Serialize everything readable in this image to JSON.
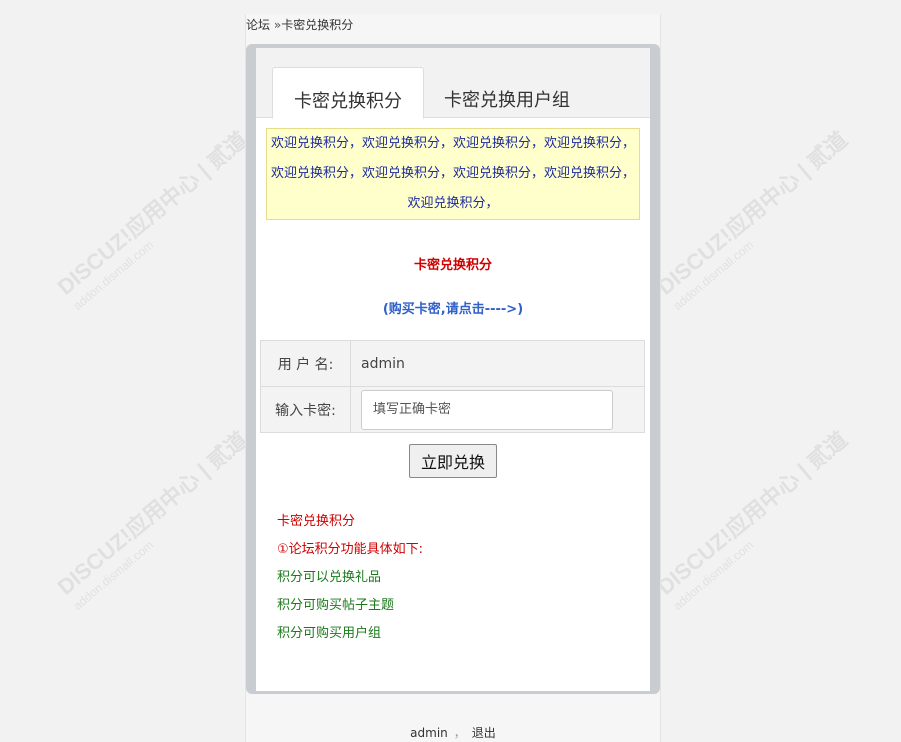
{
  "breadcrumb": {
    "forum": "论坛",
    "separator": "»",
    "current": "卡密兑换积分"
  },
  "tabs": [
    {
      "label": "卡密兑换积分",
      "active": true
    },
    {
      "label": "卡密兑换用户组",
      "active": false
    }
  ],
  "notice": "欢迎兑换积分，欢迎兑换积分，欢迎兑换积分，欢迎兑换积分，欢迎兑换积分，欢迎兑换积分，欢迎兑换积分，欢迎兑换积分，欢迎兑换积分，",
  "section_title": "卡密兑换积分",
  "buy_link": "(购买卡密,请点击---->)",
  "form": {
    "username_label": "用 户 名:",
    "username_value": "admin",
    "card_label": "输入卡密:",
    "card_placeholder": "填写正确卡密",
    "submit_label": "立即兑换"
  },
  "info": {
    "heading": "卡密兑换积分",
    "subheading": "①论坛积分功能具体如下:",
    "items": [
      "积分可以兑换礼品",
      "积分可购买帖子主题",
      "积分可购买用户组"
    ]
  },
  "footer": {
    "user": "admin",
    "separator": "，",
    "logout": "退出"
  },
  "watermark": {
    "brand": "DISCUZ!应用中心 | 贰道",
    "site": "addon.dismall.com"
  },
  "colors": {
    "accent_red": "#d00000",
    "link_blue": "#3060c8",
    "notice_text": "#1b2a9e",
    "notice_bg": "#ffffcc",
    "list_green": "#1a7a1a"
  }
}
